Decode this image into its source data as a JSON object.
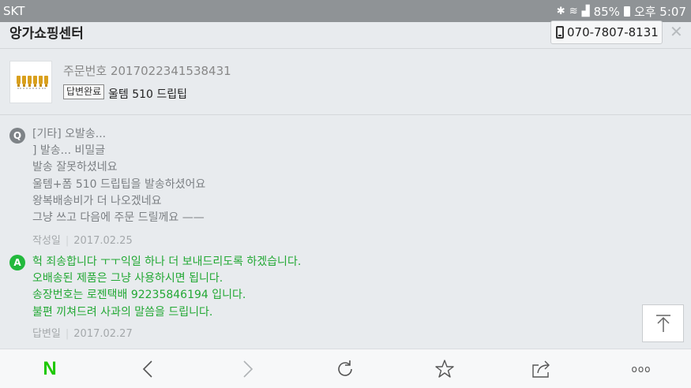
{
  "status_bar": {
    "carrier": "SKT",
    "battery": "85%",
    "time": "오후 5:07"
  },
  "header": {
    "shop_name": "앙가쇼핑센터",
    "phone": "070-7807-8131",
    "close_glyph": "✕"
  },
  "order": {
    "order_number": "주문번호 2017022341538431",
    "status_badge": "답변완료",
    "product_name": "울템 510 드립팁"
  },
  "question": {
    "icon_letter": "Q",
    "lines": [
      "[기타] 오발송...",
      "] 발송... 비밀글",
      "발송 잘못하셨네요",
      "울템+폼 510 드립팁을 발송하셨어요",
      "왕복배송비가 더 나오겠네요",
      "그냥 쓰고 다음에 주문 드릴께요 ——"
    ],
    "date_label": "작성일",
    "date": "2017.02.25"
  },
  "answer": {
    "icon_letter": "A",
    "lines": [
      "헉 죄송합니다 ㅜㅜ익일 하나 더 보내드리도록 하겠습니다.",
      "오배송된 제품은 그냥 사용하시면 됩니다.",
      "송장번호는 로젠택배 92235846194 입니다.",
      "불편 끼쳐드려 사과의 말씀을 드립니다."
    ],
    "date_label": "답변일",
    "date": "2017.02.27"
  },
  "nav": {
    "logo": "N",
    "more": "ooo"
  },
  "colors": {
    "answer_green": "#22a834",
    "naver_green": "#1ec800",
    "status_bar": "#8f9396"
  },
  "icons": [
    "bluetooth-icon",
    "wifi-icon",
    "signal-icon",
    "battery-icon",
    "phone-icon",
    "close-icon",
    "scroll-top-icon",
    "back-icon",
    "forward-icon",
    "refresh-icon",
    "bookmark-star-icon",
    "share-icon",
    "more-icon"
  ]
}
